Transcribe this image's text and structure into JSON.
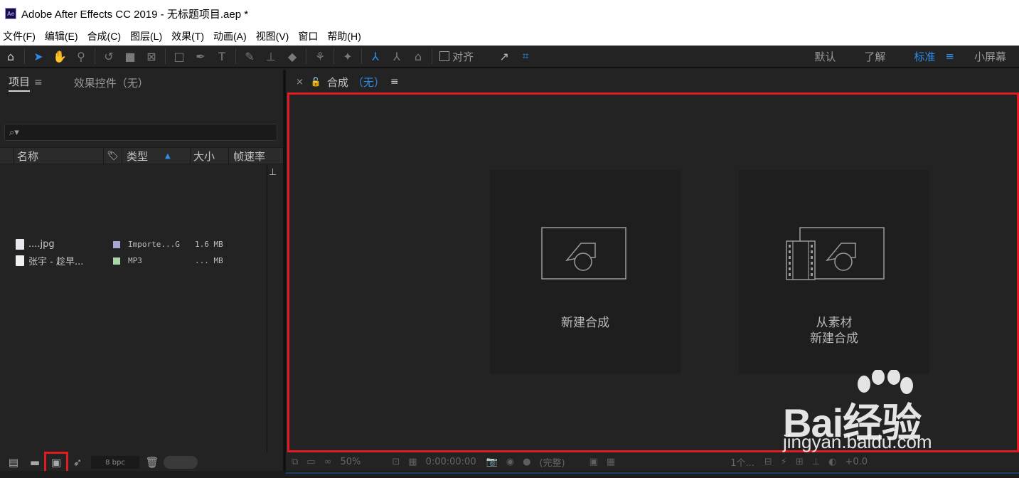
{
  "window": {
    "title": "Adobe After Effects CC 2019 - 无标题项目.aep *",
    "logo_text": "Ae"
  },
  "menu": [
    "文件(F)",
    "编辑(E)",
    "合成(C)",
    "图层(L)",
    "效果(T)",
    "动画(A)",
    "视图(V)",
    "窗口",
    "帮助(H)"
  ],
  "toolbar": {
    "align_label": "对齐",
    "workspaces": [
      "默认",
      "了解",
      "标准",
      "小屏幕"
    ],
    "active_workspace": "标准",
    "workspace_menu_icon": "≡"
  },
  "project_panel": {
    "tabs": [
      "项目",
      "效果控件（无）"
    ],
    "tab_menu_icon": "≡",
    "search_icon": "⌕▾",
    "columns": {
      "name": "名称",
      "type": "类型",
      "size": "大小",
      "fps": "帧速率"
    },
    "items": [
      {
        "name": "....jpg",
        "type": "Importe...G",
        "size": "1.6 MB",
        "color": "#a5a5d8"
      },
      {
        "name": "张宇 - 趁早...",
        "type": "MP3",
        "size": "... MB",
        "color": "#a8d8a8"
      }
    ],
    "bpc": "8 bpc"
  },
  "composition_panel": {
    "title": "合成",
    "subject": "（无）",
    "cards": [
      {
        "label_line1": "新建合成",
        "label_line2": ""
      },
      {
        "label_line1": "从素材",
        "label_line2": "新建合成"
      }
    ]
  },
  "viewer_bottom": {
    "zoom": "50%",
    "timecode": "0:00:00:00",
    "resolution": "(完整)",
    "views": "1个...",
    "exposure": "+0.0"
  },
  "watermark": {
    "brand": "Bai经验",
    "url": "jingyan.baidu.com"
  }
}
